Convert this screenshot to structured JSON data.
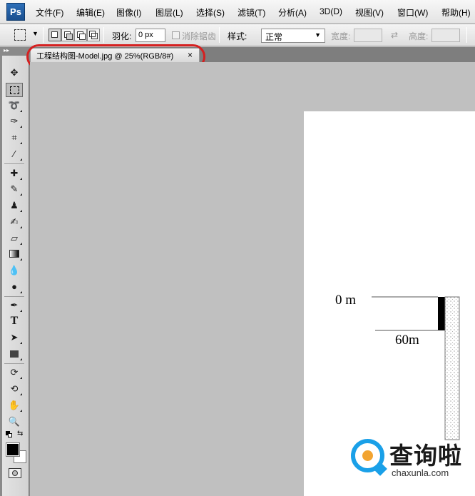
{
  "app": {
    "logo": "Ps",
    "accent": "#2a65a8"
  },
  "menu": [
    "文件(F)",
    "编辑(E)",
    "图像(I)",
    "图层(L)",
    "选择(S)",
    "滤镜(T)",
    "分析(A)",
    "3D(D)",
    "视图(V)",
    "窗口(W)",
    "帮助(H)"
  ],
  "options": {
    "feather_label": "羽化:",
    "feather_value": "0 px",
    "antialias_label": "消除锯齿",
    "style_label": "样式:",
    "style_value": "正常",
    "width_label": "宽度:",
    "height_label": "高度:"
  },
  "document_tab": {
    "title": "工程结构图-Model.jpg @ 25%(RGB/8#)",
    "close": "×"
  },
  "toolbar": {
    "tools": [
      "move",
      "rectangular-marquee",
      "lasso",
      "quick-selection",
      "crop",
      "eyedropper",
      "spot-healing",
      "brush",
      "clone-stamp",
      "history-brush",
      "eraser",
      "gradient",
      "blur",
      "dodge",
      "pen",
      "type",
      "path-selection",
      "rectangle-shape",
      "3d-rotate",
      "3d-orbit",
      "hand",
      "zoom"
    ],
    "type_glyph": "T",
    "foreground_color": "#000000",
    "background_color": "#ffffff"
  },
  "canvas": {
    "depth_label": "0  m",
    "distance_label": "60m",
    "annotation_color": "#d62020"
  },
  "watermark": {
    "text": "查询啦",
    "url": "chaxunla.com",
    "color_blue": "#1aa0e8",
    "color_orange": "#f2a431"
  }
}
